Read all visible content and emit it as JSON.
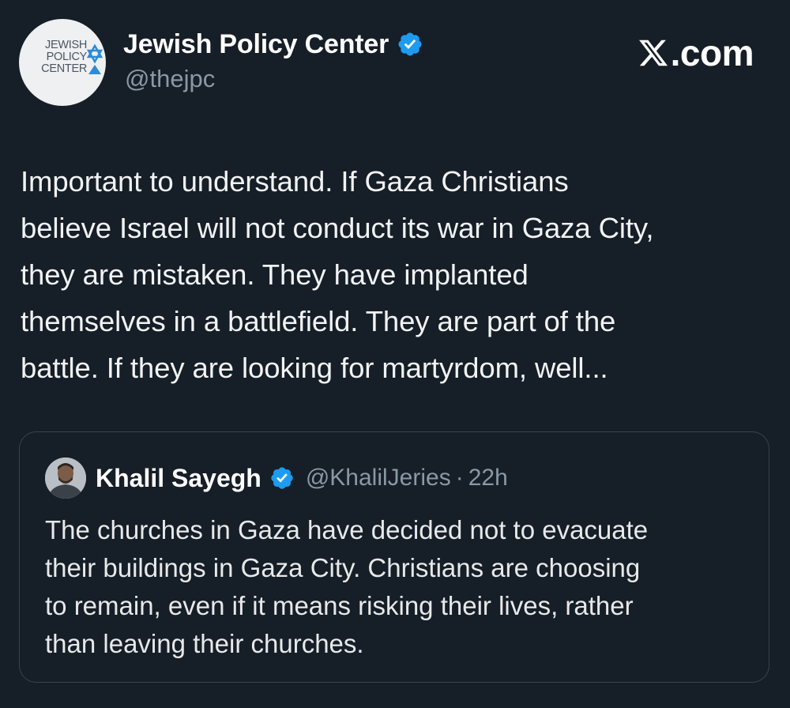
{
  "author": {
    "display_name": "Jewish Policy Center",
    "handle": "@thejpc",
    "avatar_logo": [
      "JEWISH",
      "POLICY",
      "CENTER"
    ],
    "verified_icon": "verified-check-icon"
  },
  "brand": {
    "label": ".com",
    "icon": "x-logo-icon"
  },
  "tweet": {
    "lines": [
      "Important to understand. If Gaza Christians",
      "believe Israel will not conduct its war in Gaza City,",
      "they are mistaken. They have implanted",
      "themselves in a battlefield. They are part of the",
      "battle. If they are looking for martyrdom, well..."
    ]
  },
  "quoted": {
    "display_name": "Khalil Sayegh",
    "handle": "@KhalilJeries",
    "separator": "·",
    "time": "22h",
    "verified_icon": "verified-check-icon",
    "lines": [
      "The churches in Gaza have decided not to evacuate",
      "their buildings in Gaza City. Christians are choosing",
      "to remain, even if it means risking their lives, rather",
      "than leaving their churches."
    ]
  },
  "colors": {
    "background": "#161e27",
    "verified_blue": "#1d9bf0",
    "muted_text": "#8b98a5",
    "border": "#38444d"
  }
}
